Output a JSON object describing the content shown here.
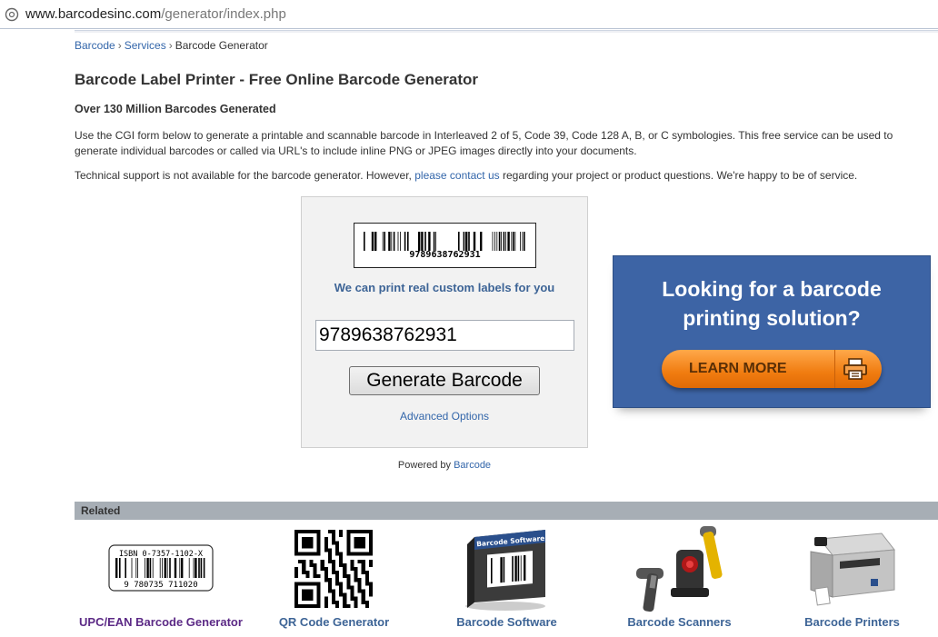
{
  "browser": {
    "url_host": "www.barcodesinc.com",
    "url_path": "/generator/index.php"
  },
  "breadcrumb": {
    "items": [
      "Barcode",
      "Services"
    ],
    "separator": "›",
    "current": "Barcode Generator"
  },
  "page": {
    "title": "Barcode Label Printer - Free Online Barcode Generator",
    "subtitle": "Over 130 Million Barcodes Generated",
    "intro": "Use the CGI form below to generate a printable and scannable barcode in Interleaved 2 of 5, Code 39, Code 128 A, B, or C symbologies. This free service can be used to generate individual barcodes or called via URL's to include inline PNG or JPEG images directly into your documents.",
    "support_before": "Technical support is not available for the barcode generator. However, ",
    "support_link": "please contact us",
    "support_after": " regarding your project or product questions. We're happy to be of service."
  },
  "generator": {
    "preview_number": "9789638762931",
    "tagline": "We can print real custom labels for you",
    "input_value": "9789638762931",
    "button_label": "Generate Barcode",
    "advanced_link": "Advanced Options",
    "powered_by_prefix": "Powered by ",
    "powered_by_link": "Barcode"
  },
  "ad": {
    "title_line1": "Looking for a barcode",
    "title_line2": "printing solution?",
    "button_label": "LEARN MORE",
    "icon": "printer-icon"
  },
  "related": {
    "heading": "Related",
    "items": [
      {
        "label": "UPC/EAN Barcode Generator",
        "icon": "upc-ean-barcode-icon",
        "isbn_text": "ISBN 0-7357-1102-X",
        "digits": "9 780735 711020"
      },
      {
        "label": "QR Code Generator",
        "icon": "qr-code-icon"
      },
      {
        "label": "Barcode Software",
        "icon": "barcode-software-box-icon",
        "box_text": "Barcode Software"
      },
      {
        "label": "Barcode Scanners",
        "icon": "barcode-scanners-icon"
      },
      {
        "label": "Barcode Printers",
        "icon": "barcode-printer-icon"
      }
    ]
  },
  "colors": {
    "link": "#3366aa",
    "visited_link": "#5c2a86",
    "ad_background": "#3d64a5",
    "ad_button": "#f07c10",
    "related_bar": "#a7aeb5"
  }
}
